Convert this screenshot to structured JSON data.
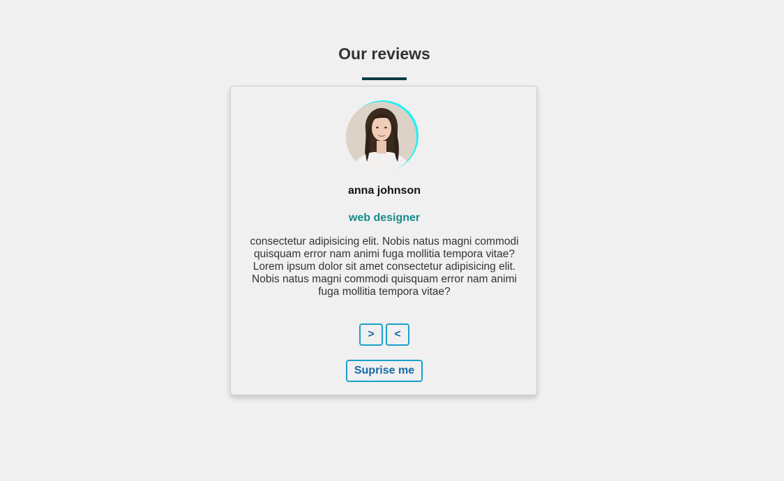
{
  "header": {
    "title": "Our reviews"
  },
  "review": {
    "name": "anna johnson",
    "job": "web designer",
    "text": "consectetur adipisicing elit. Nobis natus magni commodi quisquam error nam animi fuga mollitia tempora vitae? Lorem ipsum dolor sit amet consectetur adipisicing elit. Nobis natus magni commodi quisquam error nam animi fuga mollitia tempora vitae?"
  },
  "controls": {
    "next_label": ">",
    "prev_label": "<",
    "surprise_label": "Suprise me"
  },
  "colors": {
    "accent": "#1aa0c9",
    "button_text": "#1569a8",
    "job_text": "#178a8a",
    "avatar_ring": "#1ef2f2",
    "underline": "#0d3b3e"
  }
}
